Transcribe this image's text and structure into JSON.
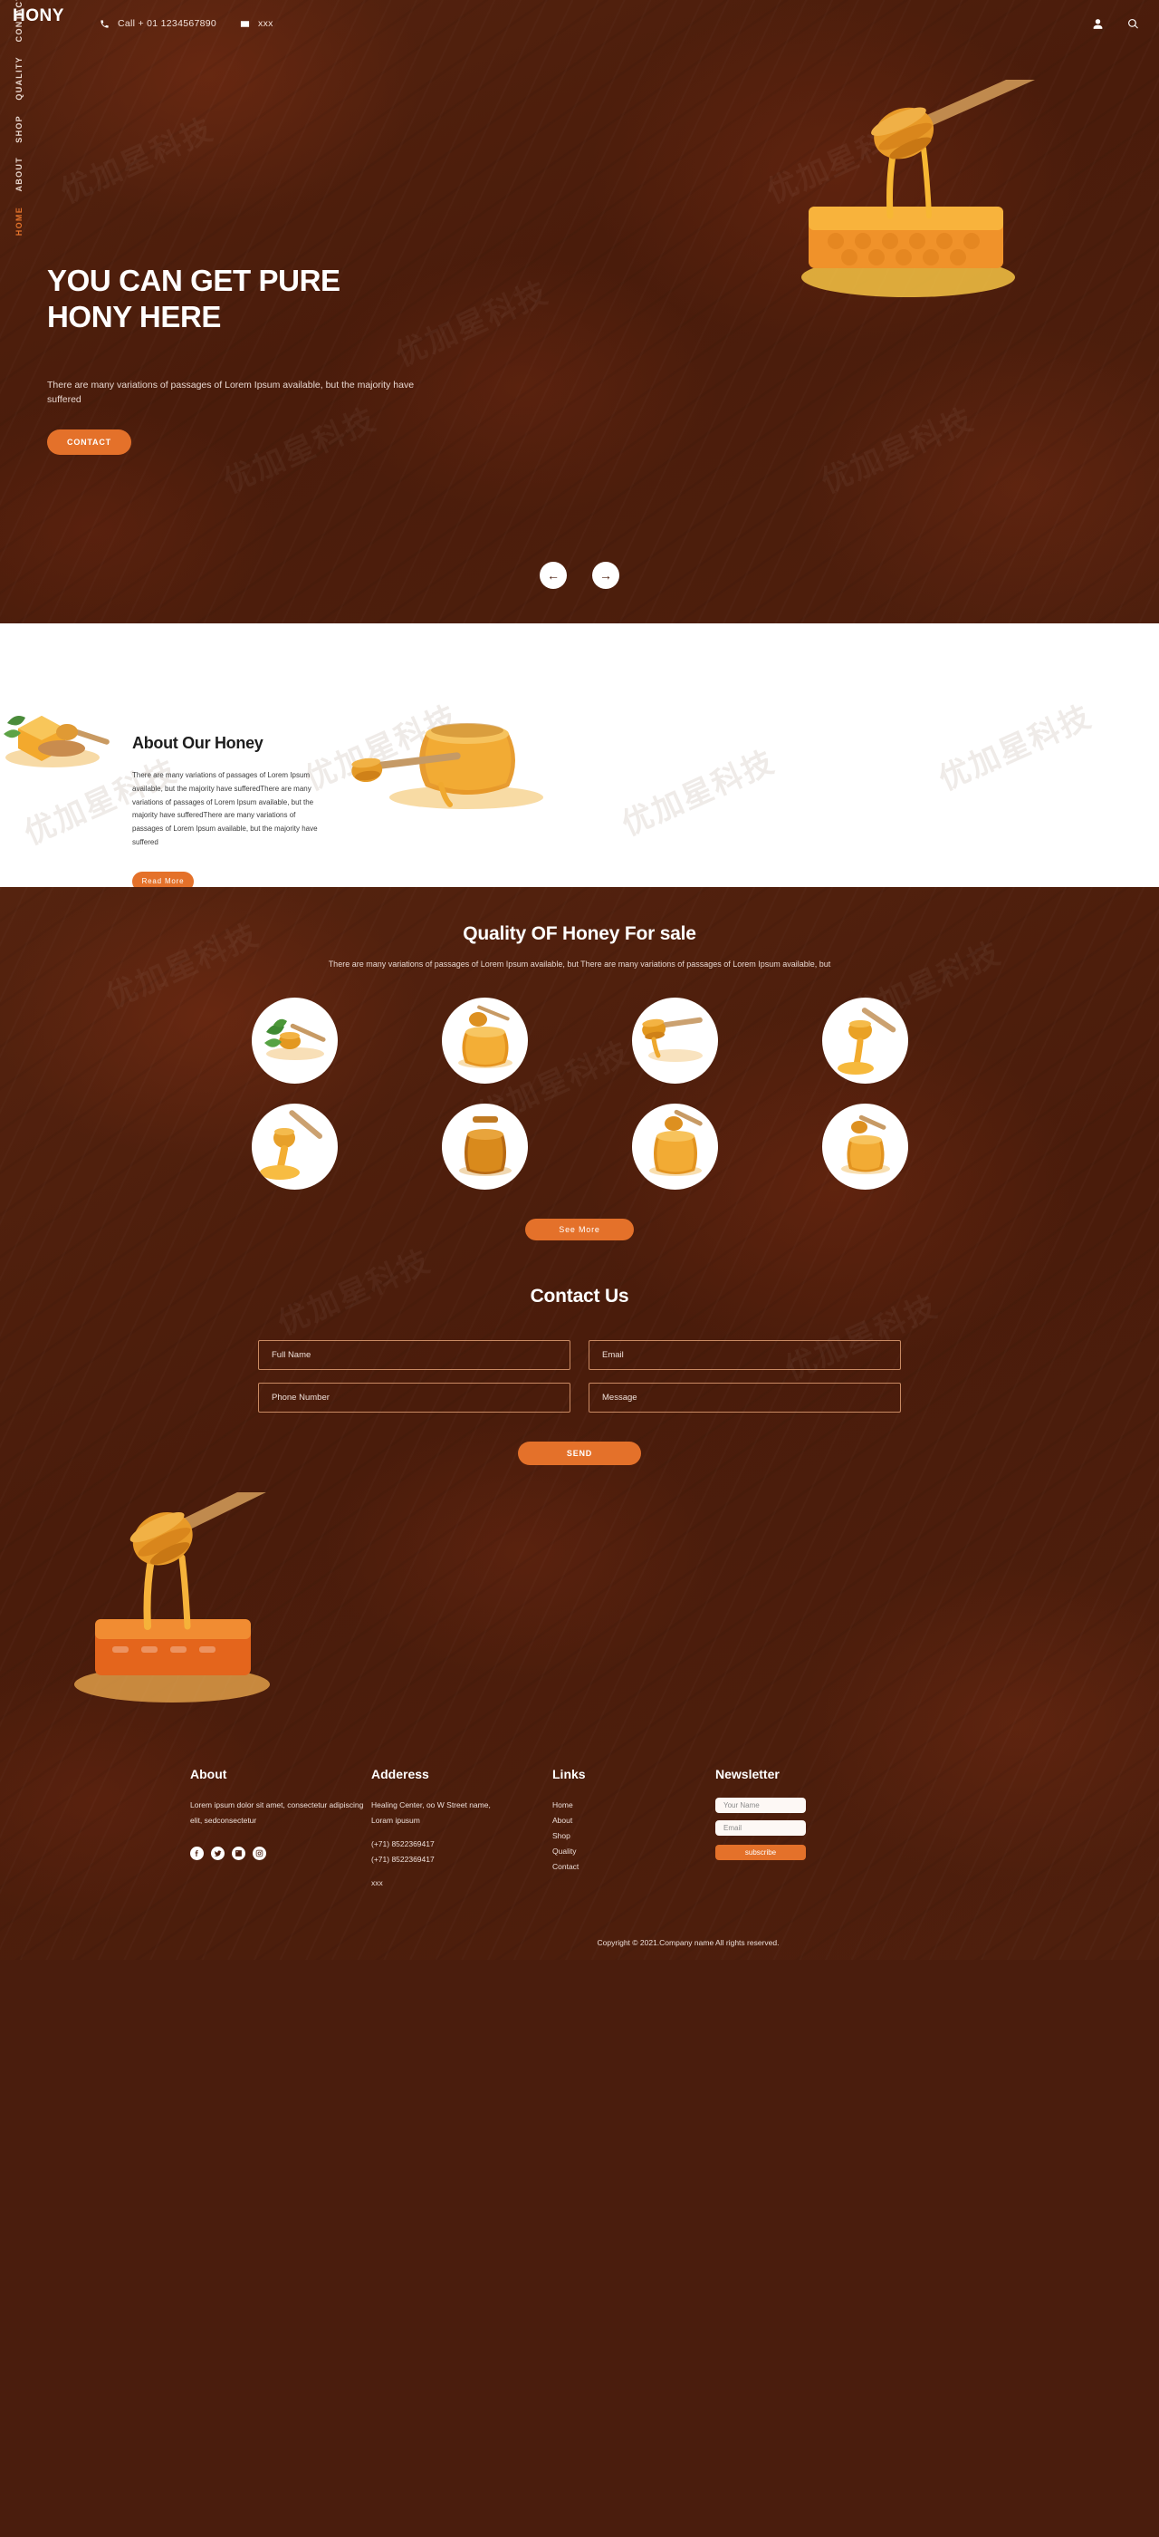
{
  "brand": {
    "logo": "HONY"
  },
  "header": {
    "phone": "Call + 01 1234567890",
    "email": "xxx",
    "phone_icon": "phone-icon",
    "mail_icon": "mail-icon",
    "account_icon": "user-icon",
    "search_icon": "search-icon"
  },
  "sidenav": {
    "items": [
      {
        "label": "HOME",
        "active": true
      },
      {
        "label": "ABOUT",
        "active": false
      },
      {
        "label": "SHOP",
        "active": false
      },
      {
        "label": "QUALITY",
        "active": false
      },
      {
        "label": "CONTACT US",
        "active": false
      }
    ]
  },
  "hero": {
    "title": "YOU CAN GET PURE HONY HERE",
    "paragraph": "There are many variations of passages of Lorem Ipsum available, but the majority have suffered",
    "cta": "CONTACT",
    "prev_arrow": "←",
    "next_arrow": "→"
  },
  "about": {
    "title": "About Our Honey",
    "paragraph": "There are many variations of passages of Lorem Ipsum available, but the majority have sufferedThere are many variations of passages of Lorem Ipsum available, but the majority have sufferedThere are many variations of passages of Lorem Ipsum available, but the majority have suffered",
    "cta": "Read More"
  },
  "quality": {
    "title": "Quality OF Honey For sale",
    "subtitle": "There are many variations of passages of Lorem Ipsum available, but There are many variations of passages of Lorem Ipsum available, but",
    "cta": "See More",
    "items": [
      {
        "name": "honey-dipper-with-herbs"
      },
      {
        "name": "honey-jar-open"
      },
      {
        "name": "honey-dipper-stick"
      },
      {
        "name": "honey-dipper-dripping"
      },
      {
        "name": "honey-dipper-pouring"
      },
      {
        "name": "honey-jar-dark"
      },
      {
        "name": "honey-jar-with-dipper"
      },
      {
        "name": "honey-jar-small"
      }
    ]
  },
  "contact": {
    "title": "Contact Us",
    "fields": [
      {
        "name": "full-name",
        "placeholder": "Full Name",
        "value": ""
      },
      {
        "name": "email",
        "placeholder": "Email",
        "value": ""
      },
      {
        "name": "phone-number",
        "placeholder": "Phone Number",
        "value": ""
      },
      {
        "name": "message",
        "placeholder": "Message",
        "value": ""
      }
    ],
    "submit": "SEND"
  },
  "footer": {
    "about": {
      "title": "About",
      "text": "Lorem ipsum dolor sit amet, consectetur adipiscing elit, sedconsectetur",
      "socials": [
        "facebook-icon",
        "twitter-icon",
        "linkedin-icon",
        "instagram-icon"
      ]
    },
    "address": {
      "title": "Adderess",
      "line1": "Healing Center, oo W Street name,",
      "line2": "Loram ipusum",
      "phone1": "(+71) 8522369417",
      "phone2": "(+71) 8522369417",
      "email": "xxx"
    },
    "links": {
      "title": "Links",
      "items": [
        "Home",
        "About",
        "Shop",
        "Quality",
        "Contact"
      ]
    },
    "newsletter": {
      "title": "Newsletter",
      "name_placeholder": "Your Name",
      "email_placeholder": "Email",
      "button": "subscribe"
    },
    "copyright": "Copyright © 2021.Company name All rights reserved."
  },
  "colors": {
    "accent": "#e4712a",
    "dark_brown": "#4a1d0d",
    "honey_gold": "#f5a623",
    "white": "#ffffff"
  }
}
